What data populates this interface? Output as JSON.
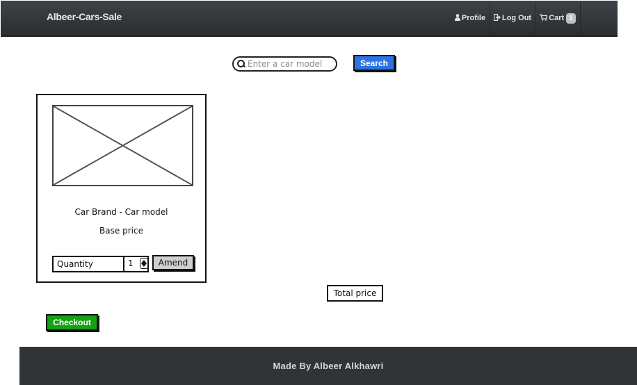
{
  "navbar": {
    "brand": "Albeer-Cars-Sale",
    "profile": {
      "icon": "user-icon",
      "label": "Profile"
    },
    "logout": {
      "icon": "logout-icon",
      "label": "Log Out"
    },
    "cart": {
      "icon": "cart-icon",
      "label": "Cart",
      "count": "1"
    }
  },
  "search": {
    "placeholder": "Enter a car model",
    "button_label": "Search"
  },
  "card": {
    "image": "image-placeholder",
    "title": "Car Brand - Car model",
    "price": "Base price",
    "quantity_label": "Quantity",
    "quantity_value": "1",
    "amend_label": "Amend"
  },
  "total_price_label": "Total price",
  "checkout_label": "Checkout",
  "footer": {
    "text": "Made By Albeer Alkhawri"
  },
  "colors": {
    "navbar": "#35393c",
    "search_button": "#2e73e6",
    "checkout_button": "#14a114",
    "footer": "#313436"
  }
}
